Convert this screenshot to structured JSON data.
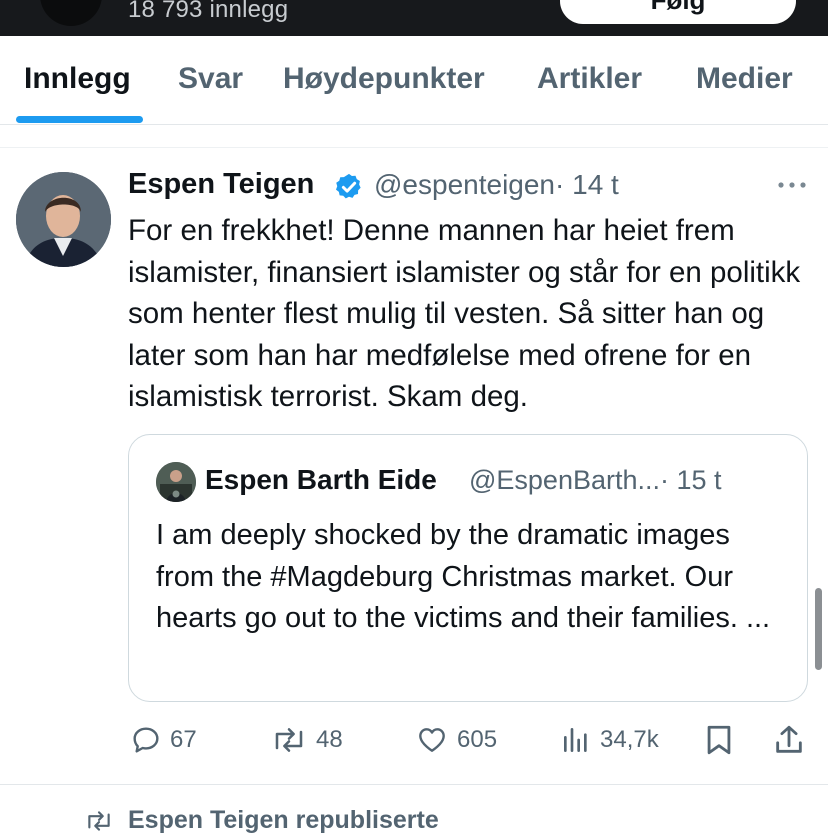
{
  "header": {
    "post_count": "18 793 innlegg",
    "follow_label": "Følg"
  },
  "tabs": [
    {
      "label": "Innlegg",
      "active": true
    },
    {
      "label": "Svar",
      "active": false
    },
    {
      "label": "Høydepunkter",
      "active": false
    },
    {
      "label": "Artikler",
      "active": false
    },
    {
      "label": "Medier",
      "active": false
    }
  ],
  "post": {
    "author_name": "Espen Teigen",
    "handle": "@espenteigen",
    "time": "· 14 t",
    "text": "For en frekkhet! Denne mannen har heiet frem islamister, finansiert islamister og står for en politikk som henter flest mulig til vesten. Så sitter han og later som han har medfølelse med ofrene for en islamistisk terrorist. Skam deg.",
    "quote": {
      "author_name": "Espen Barth Eide",
      "handle": "@EspenBarth...",
      "time": "· 15 t",
      "text": "I am deeply shocked by the dramatic images from the #Magdeburg Christmas market. Our hearts go out to the victims and their families. ..."
    },
    "actions": {
      "replies": "67",
      "reposts": "48",
      "likes": "605",
      "views": "34,7k"
    }
  },
  "next_item": {
    "repost_label": "Espen Teigen republiserte"
  },
  "colors": {
    "accent": "#1d9bf0",
    "text_primary": "#0f1419",
    "text_secondary": "#536471",
    "header_bg": "#17191c"
  }
}
